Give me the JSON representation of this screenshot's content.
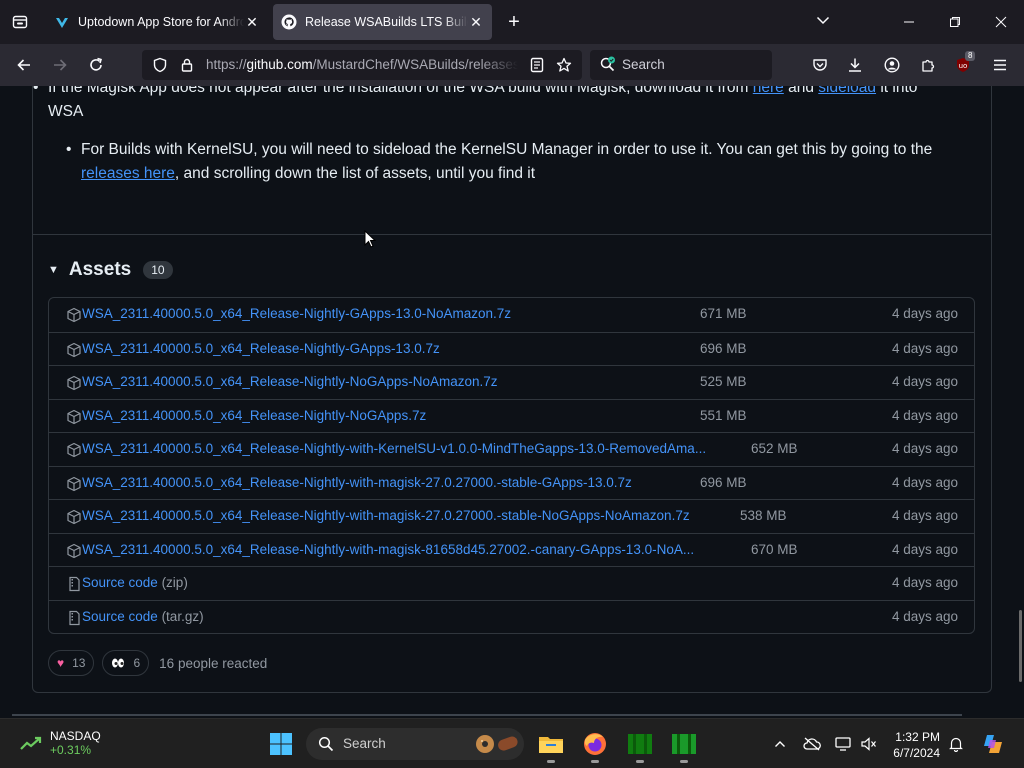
{
  "browser": {
    "tabs": [
      {
        "title": "Uptodown App Store for Andro",
        "active": false
      },
      {
        "title": "Release WSABuilds LTS Build #",
        "active": true
      }
    ],
    "url": {
      "prefix": "https://",
      "host": "github.com",
      "path": "/MustardChef/WSABuilds/releases"
    },
    "search_placeholder": "Search",
    "extension_badge": "8"
  },
  "release": {
    "bullet1": {
      "text_before": "If the Magisk App does not appear after the installation of the WSA build with Magisk, download it from ",
      "link1": "here",
      "text_mid": " and ",
      "link2": "sideload",
      "text_after": " it into WSA"
    },
    "bullet2": {
      "text_before": "For Builds with KernelSU, you will need to sideload the KernelSU Manager in order to use it. You can get this by going to the ",
      "link": "releases here",
      "text_after": ", and scrolling down the list of assets, until you find it"
    },
    "assets_title": "Assets",
    "assets_count": "10",
    "assets": [
      {
        "name": "WSA_2311.40000.5.0_x64_Release-Nightly-GApps-13.0-NoAmazon.7z",
        "suffix": "",
        "size": "671 MB",
        "date": "4 days ago",
        "kind": "package"
      },
      {
        "name": "WSA_2311.40000.5.0_x64_Release-Nightly-GApps-13.0.7z",
        "suffix": "",
        "size": "696 MB",
        "date": "4 days ago",
        "kind": "package"
      },
      {
        "name": "WSA_2311.40000.5.0_x64_Release-Nightly-NoGApps-NoAmazon.7z",
        "suffix": "",
        "size": "525 MB",
        "date": "4 days ago",
        "kind": "package"
      },
      {
        "name": "WSA_2311.40000.5.0_x64_Release-Nightly-NoGApps.7z",
        "suffix": "",
        "size": "551 MB",
        "date": "4 days ago",
        "kind": "package"
      },
      {
        "name": "WSA_2311.40000.5.0_x64_Release-Nightly-with-KernelSU-v1.0.0-MindTheGapps-13.0-RemovedAma...",
        "suffix": "",
        "size": "652 MB",
        "date": "4 days ago",
        "kind": "package"
      },
      {
        "name": "WSA_2311.40000.5.0_x64_Release-Nightly-with-magisk-27.0.27000.-stable-GApps-13.0.7z",
        "suffix": "",
        "size": "696 MB",
        "date": "4 days ago",
        "kind": "package"
      },
      {
        "name": "WSA_2311.40000.5.0_x64_Release-Nightly-with-magisk-27.0.27000.-stable-NoGApps-NoAmazon.7z",
        "suffix": "",
        "size": "538 MB",
        "date": "4 days ago",
        "kind": "package"
      },
      {
        "name": "WSA_2311.40000.5.0_x64_Release-Nightly-with-magisk-81658d45.27002.-canary-GApps-13.0-NoA...",
        "suffix": "",
        "size": "670 MB",
        "date": "4 days ago",
        "kind": "package"
      },
      {
        "name": "Source code",
        "suffix": " (zip)",
        "size": "",
        "date": "4 days ago",
        "kind": "zip"
      },
      {
        "name": "Source code",
        "suffix": " (tar.gz)",
        "size": "",
        "date": "4 days ago",
        "kind": "zip"
      }
    ],
    "reactions": [
      {
        "emoji": "heart",
        "count": "13"
      },
      {
        "emoji": "eyes",
        "count": "6"
      }
    ],
    "reactions_summary": "16 people reacted"
  },
  "taskbar": {
    "stock_name": "NASDAQ",
    "stock_change": "+0.31%",
    "search_placeholder": "Search",
    "time": "1:32 PM",
    "date": "6/7/2024"
  }
}
